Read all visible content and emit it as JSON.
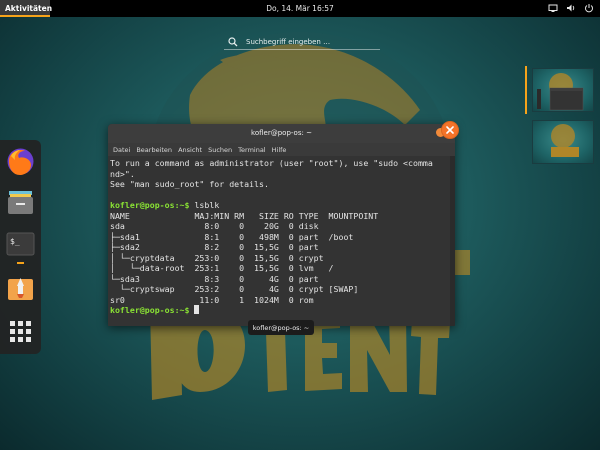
{
  "topbar": {
    "activities": "Aktivitäten",
    "clock": "Do, 14. Mär  16:57",
    "tray_icons": [
      "screen-icon",
      "volume-icon",
      "power-icon"
    ]
  },
  "search": {
    "placeholder": "Suchbegriff eingeben …"
  },
  "dock": {
    "items": [
      "firefox",
      "files",
      "terminal",
      "pop-shop",
      "app-grid"
    ]
  },
  "terminal": {
    "title": "kofler@pop-os: ~",
    "menu": [
      "Datei",
      "Bearbeiten",
      "Ansicht",
      "Suchen",
      "Terminal",
      "Hilfe"
    ],
    "lines": [
      "To run a command as administrator (user \"root\"), use \"sudo <comma",
      "nd>\".",
      "See \"man sudo_root\" for details.",
      "",
      "",
      "NAME             MAJ:MIN RM   SIZE RO TYPE  MOUNTPOINT",
      "sda                8:0    0    20G  0 disk",
      "├─sda1             8:1    0   498M  0 part  /boot",
      "├─sda2             8:2    0  15,5G  0 part",
      "│ └─cryptdata    253:0    0  15,5G  0 crypt",
      "│   └─data-root  253:1    0  15,5G  0 lvm   /",
      "└─sda3             8:3    0     4G  0 part",
      "  └─cryptswap    253:2    0     4G  0 crypt [SWAP]",
      "sr0               11:0    1  1024M  0 rom"
    ],
    "prompt": "kofler@pop-os:~$",
    "command": " lsblk"
  },
  "tooltip": "kofler@pop-os: ~",
  "colors": {
    "accent": "#f6a31a",
    "prompt": "#8ae234",
    "close": "#f37329"
  }
}
